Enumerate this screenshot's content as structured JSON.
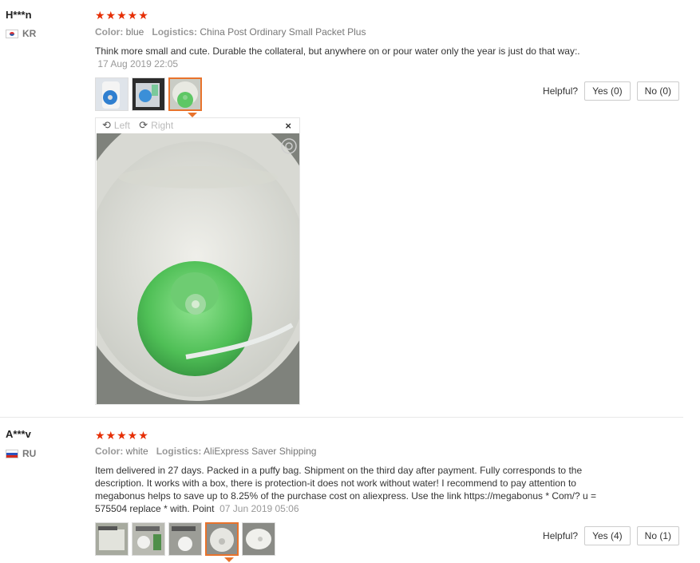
{
  "reviews": [
    {
      "user": "H***n",
      "country": "KR",
      "stars": "★★★★★",
      "color_label": "Color:",
      "color_value": "blue",
      "logistics_label": "Logistics:",
      "logistics_value": "China Post Ordinary Small Packet Plus",
      "text": "Think more small and cute. Durable the collateral, but anywhere on or pour water only the year is just do that way:.",
      "date": "17 Aug 2019 22:05",
      "helpful_label": "Helpful?",
      "yes_label": "Yes (0)",
      "no_label": "No (0)",
      "viewer": {
        "left_label": "Left",
        "right_label": "Right",
        "close_label": "×"
      }
    },
    {
      "user": "A***v",
      "country": "RU",
      "stars": "★★★★★",
      "color_label": "Color:",
      "color_value": "white",
      "logistics_label": "Logistics:",
      "logistics_value": "AliExpress Saver Shipping",
      "text": "Item delivered in 27 days. Packed in a puffy bag. Shipment on the third day after payment. Fully corresponds to the description. It works with a box, there is protection-it does not work without water! I recommend to pay attention to megabonus helps to save up to 8.25% of the purchase cost on aliexpress. Use the link https://megabonus * Com/? u = 575504 replace * with. Point",
      "date": "07 Jun 2019 05:06",
      "helpful_label": "Helpful?",
      "yes_label": "Yes (4)",
      "no_label": "No (1)"
    }
  ],
  "colors": {
    "star": "#e62e04",
    "selected_border": "#e8732c",
    "meta": "#999999"
  }
}
